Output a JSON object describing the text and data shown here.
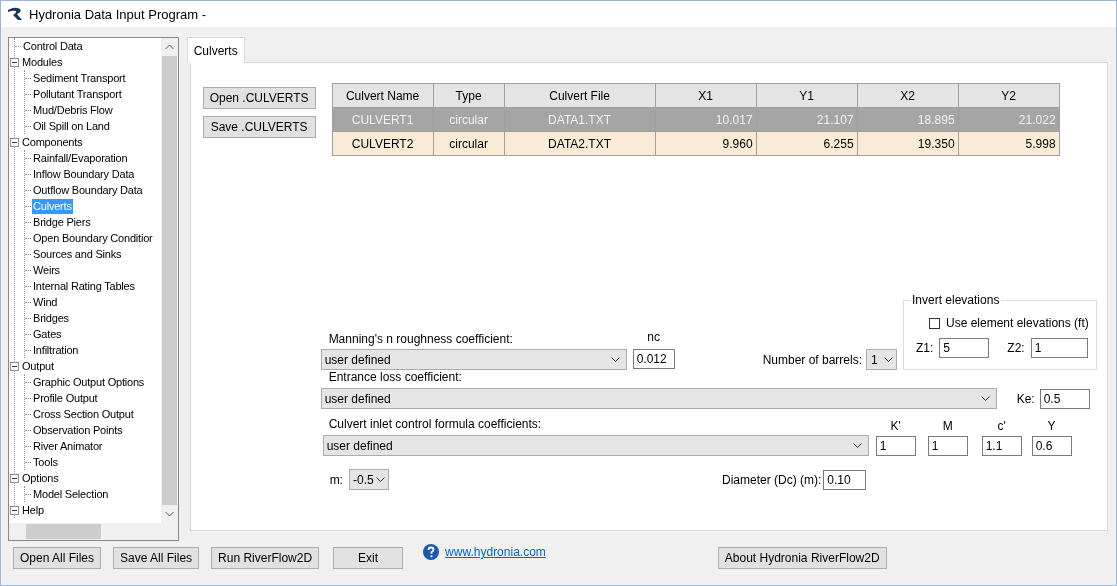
{
  "window": {
    "title": "Hydronia Data Input Program -"
  },
  "tree": [
    {
      "label": "Control Data",
      "selected": false
    },
    {
      "label": "Modules",
      "selected": false,
      "expanded": true,
      "children": [
        {
          "label": "Sediment Transport",
          "selected": false
        },
        {
          "label": "Pollutant Transport",
          "selected": false
        },
        {
          "label": "Mud/Debris Flow",
          "selected": false
        },
        {
          "label": "Oil Spill on Land",
          "selected": false
        }
      ]
    },
    {
      "label": "Components",
      "selected": false,
      "expanded": true,
      "children": [
        {
          "label": "Rainfall/Evaporation",
          "selected": false
        },
        {
          "label": "Inflow Boundary Data",
          "selected": false
        },
        {
          "label": "Outflow Boundary Data",
          "selected": false
        },
        {
          "label": "Culverts",
          "selected": true
        },
        {
          "label": "Bridge Piers",
          "selected": false
        },
        {
          "label": "Open Boundary Conditior",
          "selected": false
        },
        {
          "label": "Sources and Sinks",
          "selected": false
        },
        {
          "label": "Weirs",
          "selected": false
        },
        {
          "label": "Internal Rating Tables",
          "selected": false
        },
        {
          "label": "Wind",
          "selected": false
        },
        {
          "label": "Bridges",
          "selected": false
        },
        {
          "label": "Gates",
          "selected": false
        },
        {
          "label": "Infiltration",
          "selected": false
        }
      ]
    },
    {
      "label": "Output",
      "selected": false,
      "expanded": true,
      "children": [
        {
          "label": "Graphic Output Options",
          "selected": false
        },
        {
          "label": "Profile Output",
          "selected": false
        },
        {
          "label": "Cross Section Output",
          "selected": false
        },
        {
          "label": "Observation Points",
          "selected": false
        },
        {
          "label": "River Animator",
          "selected": false
        },
        {
          "label": "Tools",
          "selected": false
        }
      ]
    },
    {
      "label": "Options",
      "selected": false,
      "expanded": true,
      "children": [
        {
          "label": "Model Selection",
          "selected": false
        }
      ]
    },
    {
      "label": "Help",
      "selected": false,
      "expanded": true
    }
  ],
  "tabs": [
    {
      "label": "Culverts",
      "selected": true
    }
  ],
  "file_buttons": [
    "Open .CULVERTS",
    "Save .CULVERTS"
  ],
  "table": {
    "columns": [
      "Culvert Name",
      "Type",
      "Culvert File",
      "X1",
      "Y1",
      "X2",
      "Y2"
    ],
    "rows": [
      {
        "selected": true,
        "cells": [
          "CULVERT1",
          "circular",
          "DATA1.TXT",
          "10.017",
          "21.107",
          "18.895",
          "21.022"
        ]
      },
      {
        "selected": false,
        "cells": [
          "CULVERT2",
          "circular",
          "DATA2.TXT",
          "9.960",
          "6.255",
          "19.350",
          "5.998"
        ]
      }
    ]
  },
  "form": {
    "manning": {
      "label": "Manning's n roughness coefficient:",
      "value": "user defined",
      "nc_label": "nc",
      "nc_value": "0.012"
    },
    "barrels": {
      "label": "Number of barrels:",
      "value": "1"
    },
    "invert": {
      "title": "Invert elevations",
      "checkbox": {
        "label": "Use element elevations (ft)",
        "checked": false
      },
      "z1_label": "Z1:",
      "z1": "5",
      "z2_label": "Z2:",
      "z2": "1"
    },
    "entrance": {
      "label": "Entrance loss coefficient:",
      "value": "user defined",
      "ke_label": "Ke:",
      "ke": "0.5"
    },
    "inlet": {
      "label": "Culvert inlet control formula coefficients:",
      "value": "user defined",
      "coefficients": [
        {
          "label": "K'",
          "value": "1"
        },
        {
          "label": "M",
          "value": "1"
        },
        {
          "label": "c'",
          "value": "1.1"
        },
        {
          "label": "Y",
          "value": "0.6"
        }
      ]
    },
    "m": {
      "label": "m:",
      "value": "-0.5"
    },
    "diameter": {
      "label": "Diameter (Dc) (m):",
      "value": "0.10"
    }
  },
  "bottom_buttons": [
    "Open All Files",
    "Save All Files",
    "Run RiverFlow2D",
    "Exit"
  ],
  "link": "www.hydronia.com",
  "about_button": "About Hydronia RiverFlow2D"
}
